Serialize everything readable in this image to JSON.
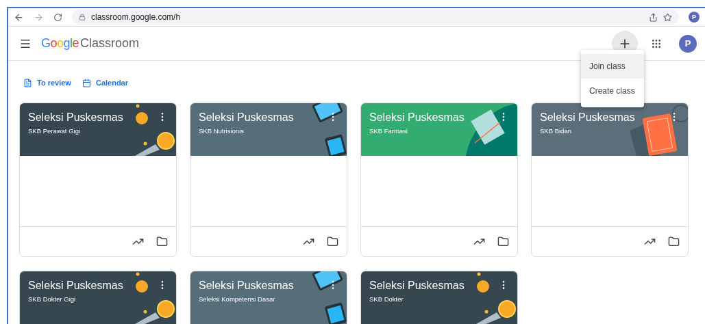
{
  "browser": {
    "url": "classroom.google.com/h",
    "profile_initial": "P"
  },
  "header": {
    "logo_google": "Google",
    "logo_product": "Classroom",
    "avatar_initial": "P"
  },
  "create_menu": [
    {
      "label": "Join class",
      "selected": true
    },
    {
      "label": "Create class",
      "selected": false
    }
  ],
  "nav_links": [
    {
      "label": "To review",
      "kind": "review"
    },
    {
      "label": "Calendar",
      "kind": "calendar"
    }
  ],
  "classes": [
    {
      "title": "Seleksi Puskesmas",
      "section": "SKB Perawat Gigi",
      "kind": "coins",
      "color": "#37474f"
    },
    {
      "title": "Seleksi Puskesmas",
      "section": "SKB Nutrisionis",
      "kind": "tablets",
      "color": "#566d7a"
    },
    {
      "title": "Seleksi Puskesmas",
      "section": "SKB Farmasi",
      "kind": "book",
      "color": "#33ac71"
    },
    {
      "title": "Seleksi Puskesmas",
      "section": "SKB Bidan",
      "kind": "notebook",
      "color": "#5b6e7a"
    },
    {
      "title": "Seleksi Puskesmas",
      "section": "SKB Dokter Gigi",
      "kind": "coins",
      "color": "#37474f"
    },
    {
      "title": "Seleksi Puskesmas",
      "section": "Seleksi Kompetensi Dasar",
      "kind": "tablets",
      "color": "#566d7a"
    },
    {
      "title": "Seleksi Puskesmas",
      "section": "SKB Dokter",
      "kind": "coins",
      "color": "#37474f"
    }
  ]
}
